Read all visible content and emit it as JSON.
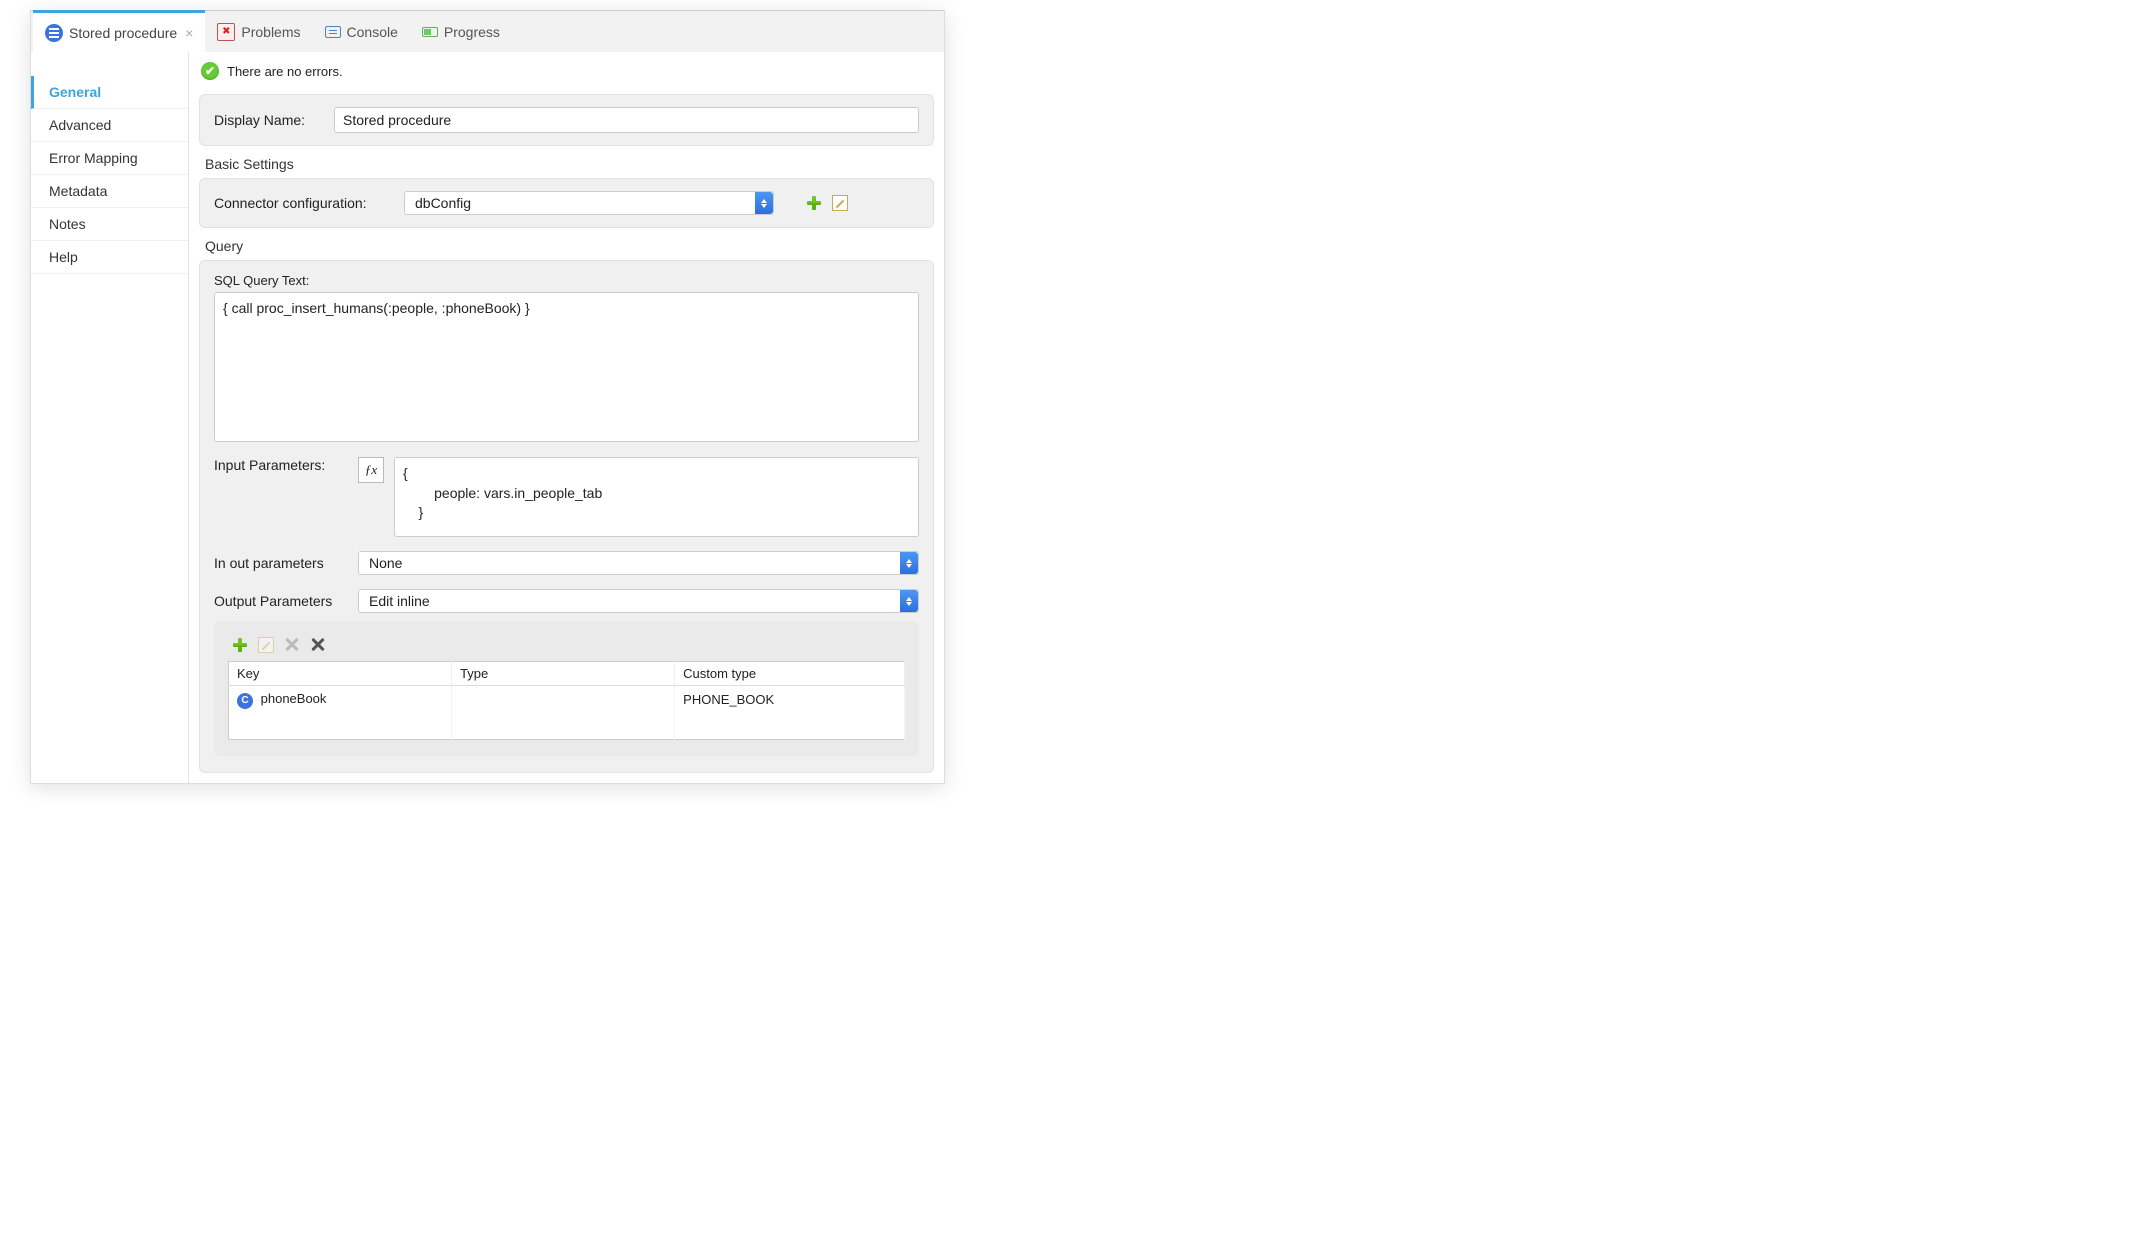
{
  "tabs": [
    {
      "label": "Stored procedure",
      "active": true
    },
    {
      "label": "Problems"
    },
    {
      "label": "Console"
    },
    {
      "label": "Progress"
    }
  ],
  "status": {
    "message": "There are no errors."
  },
  "sidebar": {
    "items": [
      {
        "label": "General",
        "active": true
      },
      {
        "label": "Advanced"
      },
      {
        "label": "Error Mapping"
      },
      {
        "label": "Metadata"
      },
      {
        "label": "Notes"
      },
      {
        "label": "Help"
      }
    ]
  },
  "displayName": {
    "label": "Display Name:",
    "value": "Stored procedure"
  },
  "basicSettings": {
    "title": "Basic Settings",
    "connectorLabel": "Connector configuration:",
    "connectorValue": "dbConfig"
  },
  "query": {
    "title": "Query",
    "sqlLabel": "SQL Query Text:",
    "sqlValue": "{ call proc_insert_humans(:people, :phoneBook) }",
    "inputParamsLabel": "Input Parameters:",
    "inputParamsValue": "{\n        people: vars.in_people_tab\n    }",
    "inOutLabel": "In out parameters",
    "inOutValue": "None",
    "outputLabel": "Output Parameters",
    "outputValue": "Edit inline",
    "table": {
      "headers": {
        "key": "Key",
        "type": "Type",
        "custom": "Custom type"
      },
      "rows": [
        {
          "key": "phoneBook",
          "type": "",
          "custom": "PHONE_BOOK"
        }
      ]
    }
  }
}
